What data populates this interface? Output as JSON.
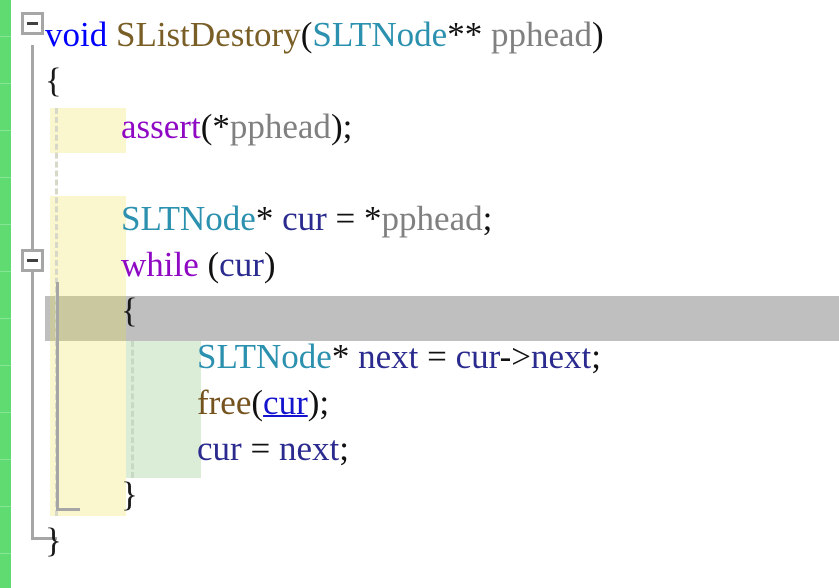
{
  "editor": {
    "app_kind": "code-editor-pane",
    "language": "C",
    "font_size_px": 35,
    "line_height_px": 46,
    "colors": {
      "background": "#ffffff",
      "keyword": "#0000ff",
      "keyword_control": "#8f08c4",
      "type_name": "#2b91af",
      "function_name": "#795e26",
      "local_variable": "#2b2b8f",
      "parameter": "#808080",
      "punctuation": "#111111",
      "current_line_selection": "#bfbfbf",
      "indent_block_level1": "#faf6cd",
      "indent_block_level2": "#dcedd7",
      "indent_block_overlap": "#c9c89f",
      "change_margin_green": "#5fdb71",
      "change_margin_seam": "#86e694",
      "structure_guide": "#a6a6a6",
      "indent_guide_level1": "#d8d8c8",
      "indent_guide_level2": "#c7d9c2",
      "reference_link": "#1414cf"
    },
    "outlining": [
      {
        "name": "collapse-toggle-function",
        "state": "expanded",
        "glyph": "minus-box-icon",
        "line": 1
      },
      {
        "name": "collapse-toggle-while",
        "state": "expanded",
        "glyph": "minus-box-icon",
        "line": 5
      }
    ],
    "current_line_number": 6,
    "lines": [
      {
        "n": 1,
        "indent": 0,
        "tokens": [
          {
            "t": "void",
            "c": "kw"
          },
          {
            "t": " ",
            "c": "plain"
          },
          {
            "t": "SListDestory",
            "c": "fn"
          },
          {
            "t": "(",
            "c": "punct"
          },
          {
            "t": "SLTNode",
            "c": "type"
          },
          {
            "t": "**",
            "c": "op"
          },
          {
            "t": " ",
            "c": "plain"
          },
          {
            "t": "pphead",
            "c": "param"
          },
          {
            "t": ")",
            "c": "punct"
          }
        ]
      },
      {
        "n": 2,
        "indent": 0,
        "tokens": [
          {
            "t": "{",
            "c": "brace"
          }
        ]
      },
      {
        "n": 3,
        "indent": 1,
        "tokens": [
          {
            "t": "assert",
            "c": "kw2"
          },
          {
            "t": "(",
            "c": "punct"
          },
          {
            "t": "*",
            "c": "op"
          },
          {
            "t": "pphead",
            "c": "param"
          },
          {
            "t": ")",
            "c": "punct"
          },
          {
            "t": ";",
            "c": "punct"
          }
        ]
      },
      {
        "n": 4,
        "indent": 1,
        "tokens": []
      },
      {
        "n": 5,
        "indent": 1,
        "tokens": [
          {
            "t": "SLTNode",
            "c": "type"
          },
          {
            "t": "*",
            "c": "op"
          },
          {
            "t": " ",
            "c": "plain"
          },
          {
            "t": "cur",
            "c": "var"
          },
          {
            "t": " = ",
            "c": "op"
          },
          {
            "t": "*",
            "c": "op"
          },
          {
            "t": "pphead",
            "c": "param"
          },
          {
            "t": ";",
            "c": "punct"
          }
        ]
      },
      {
        "n": 6,
        "indent": 1,
        "tokens": [
          {
            "t": "while",
            "c": "kw2"
          },
          {
            "t": " ",
            "c": "plain"
          },
          {
            "t": "(",
            "c": "punct"
          },
          {
            "t": "cur",
            "c": "var"
          },
          {
            "t": ")",
            "c": "punct"
          }
        ]
      },
      {
        "n": 7,
        "indent": 1,
        "selected": true,
        "tokens": [
          {
            "t": "{",
            "c": "brace"
          }
        ]
      },
      {
        "n": 8,
        "indent": 2,
        "tokens": [
          {
            "t": "SLTNode",
            "c": "type"
          },
          {
            "t": "*",
            "c": "op"
          },
          {
            "t": " ",
            "c": "plain"
          },
          {
            "t": "next",
            "c": "var"
          },
          {
            "t": " = ",
            "c": "op"
          },
          {
            "t": "cur",
            "c": "var"
          },
          {
            "t": "->",
            "c": "op"
          },
          {
            "t": "next",
            "c": "var"
          },
          {
            "t": ";",
            "c": "punct"
          }
        ]
      },
      {
        "n": 9,
        "indent": 2,
        "tokens": [
          {
            "t": "free",
            "c": "fn2"
          },
          {
            "t": "(",
            "c": "punct"
          },
          {
            "t": "cur",
            "c": "linkref"
          },
          {
            "t": ")",
            "c": "punct"
          },
          {
            "t": ";",
            "c": "punct"
          }
        ]
      },
      {
        "n": 10,
        "indent": 2,
        "tokens": [
          {
            "t": "cur",
            "c": "var"
          },
          {
            "t": " = ",
            "c": "op"
          },
          {
            "t": "next",
            "c": "var"
          },
          {
            "t": ";",
            "c": "punct"
          }
        ]
      },
      {
        "n": 11,
        "indent": 1,
        "tokens": [
          {
            "t": "}",
            "c": "brace"
          }
        ]
      },
      {
        "n": 12,
        "indent": 0,
        "tokens": [
          {
            "t": "}",
            "c": "brace"
          }
        ]
      }
    ],
    "source_text": "void SListDestory(SLTNode** pphead)\n{\n\tassert(*pphead);\n\n\tSLTNode* cur = *pphead;\n\twhile (cur)\n\t{\n\t\tSLTNode* next = cur->next;\n\t\tfree(cur);\n\t\tcur = next;\n\t}\n}"
  }
}
